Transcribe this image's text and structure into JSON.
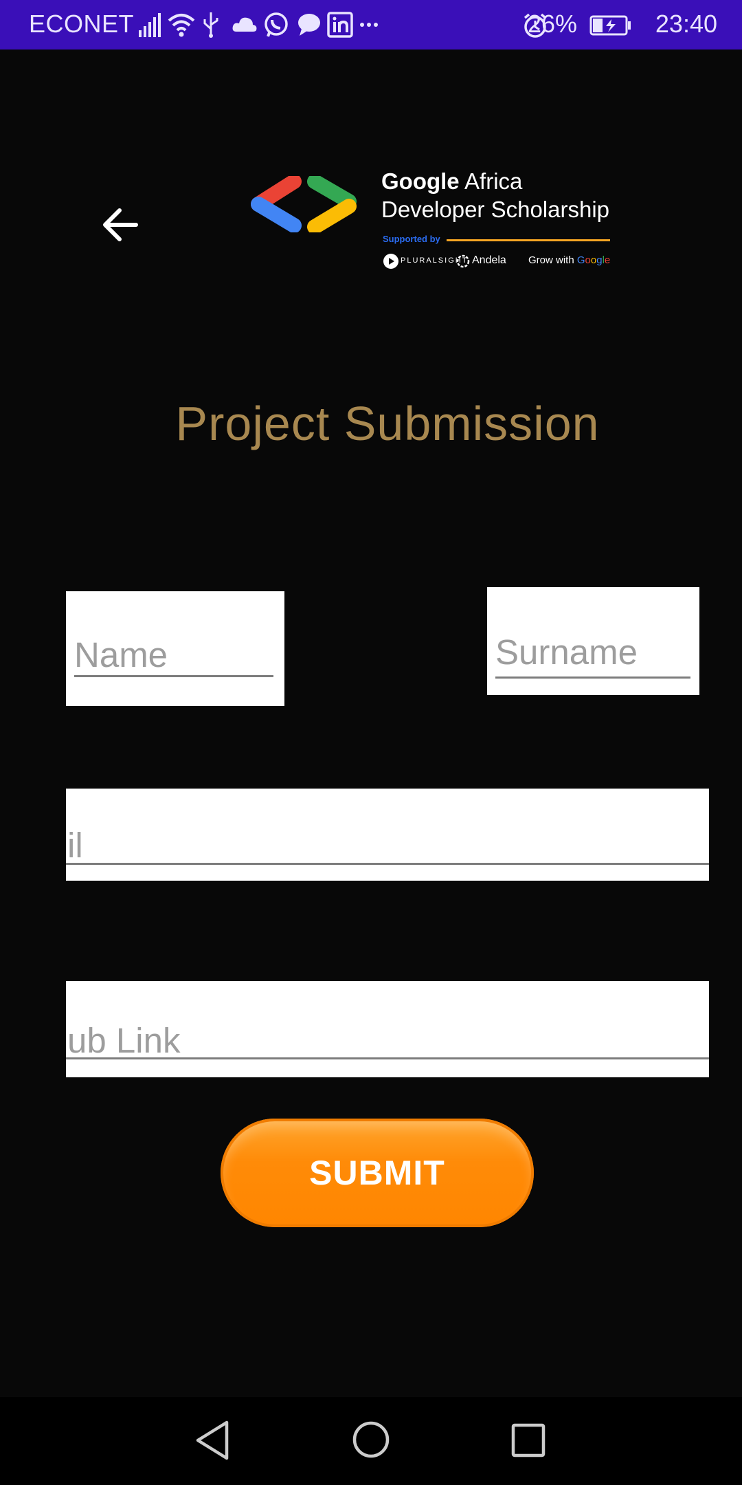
{
  "status_bar": {
    "carrier": "ECONET",
    "battery": "26%",
    "time": "23:40",
    "icons": [
      "signal-icon",
      "wifi-icon",
      "usb-icon",
      "cloud-icon",
      "whatsapp-icon",
      "message-icon",
      "linkedin-icon",
      "more-icon",
      "alarm-icon",
      "battery-charging-icon"
    ],
    "background": "#3a0fb8"
  },
  "header": {
    "logo": {
      "brand": "Google",
      "line1_rest": " Africa",
      "line2": "Developer Scholarship",
      "supported_by": "Supported by",
      "partner_pluralsight": "PLURALSIGHT",
      "partner_andela": "Andela",
      "partner_grow": "Grow with ",
      "grow_google": [
        "G",
        "o",
        "o",
        "g",
        "l",
        "e"
      ]
    }
  },
  "title": "Project Submission",
  "form": {
    "name_placeholder": "Name",
    "surname_placeholder": "Surname",
    "email_placeholder": "il",
    "github_placeholder": "ub Link",
    "submit_label": "SUBMIT"
  },
  "colors": {
    "title": "#a88850",
    "submit": "#ff8b08",
    "background": "#080808"
  }
}
